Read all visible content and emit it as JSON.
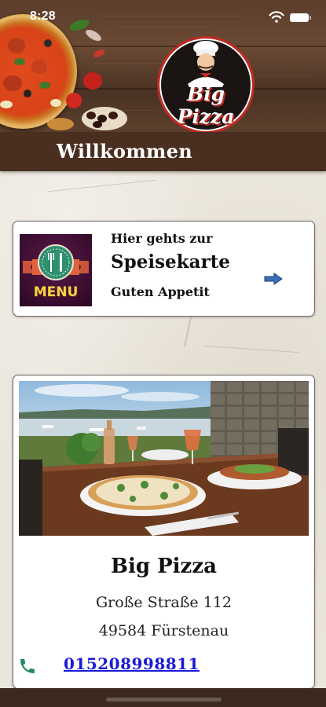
{
  "status_bar": {
    "time": "8:28",
    "icons": [
      "wifi-icon",
      "battery-icon"
    ]
  },
  "header": {
    "logo_text": "Big Pizza",
    "title": "Willkommen"
  },
  "menu_card": {
    "thumb_label": "MENU",
    "line1": "Hier gehts zur",
    "line2": "Speisekarte",
    "line3": "Guten Appetit",
    "arrow_icon": "right-arrow-icon"
  },
  "restaurant": {
    "name": "Big Pizza",
    "street": "Große Straße 112",
    "city": "49584 Fürstenau",
    "phone": "015208998811",
    "phone_icon": "phone-icon"
  },
  "colors": {
    "header_bar": "#4a2e1f",
    "link": "#1a1ad6",
    "phone_icon": "#1f8a5a",
    "arrow": "#3a6fb8",
    "logo_ring": "#c22a22"
  }
}
